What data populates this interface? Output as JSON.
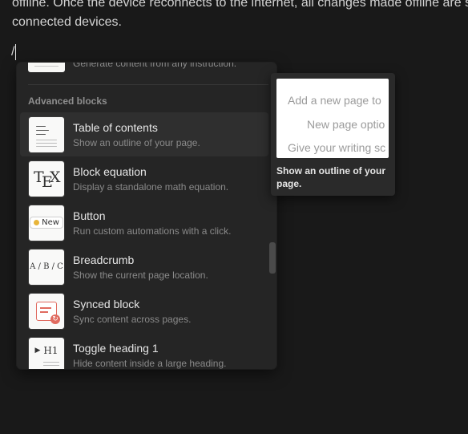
{
  "paragraph": {
    "line1": "offline. Once the device reconnects to the internet, all changes made offline are s",
    "line2": "connected devices."
  },
  "editor": {
    "slash_text": "/"
  },
  "menu": {
    "partial_item_desc": "Generate content from any instruction.",
    "section_label": "Advanced blocks",
    "items": [
      {
        "title": "Table of contents",
        "desc": "Show an outline of your page.",
        "icon": "table-of-contents-icon"
      },
      {
        "title": "Block equation",
        "desc": "Display a standalone math equation.",
        "icon": "tex-icon"
      },
      {
        "title": "Button",
        "desc": "Run custom automations with a click.",
        "icon": "button-icon"
      },
      {
        "title": "Breadcrumb",
        "desc": "Show the current page location.",
        "icon": "breadcrumb-icon"
      },
      {
        "title": "Synced block",
        "desc": "Sync content across pages.",
        "icon": "synced-block-icon"
      },
      {
        "title": "Toggle heading 1",
        "desc": "Hide content inside a large heading.",
        "icon": "toggle-heading-icon"
      }
    ],
    "thumbs": {
      "tex": {
        "t": "T",
        "e": "E",
        "x": "X"
      },
      "button": "New",
      "breadcrumb": "A / B / C",
      "sync_badge": "↻",
      "toggle_marker": "▶",
      "toggle_heading": "H1"
    }
  },
  "preview": {
    "lines": [
      "Add a new page to",
      "New page optio",
      "Give your writing sc"
    ],
    "caption": "Show an outline of your page."
  },
  "colors": {
    "background": "#191919",
    "menu_bg": "#252525",
    "selected_bg": "#2f2f2f",
    "sync_accent": "#e06a5f",
    "button_dot": "#e8b53a"
  }
}
